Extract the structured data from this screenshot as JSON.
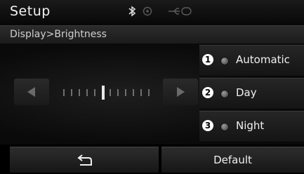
{
  "header": {
    "title": "Setup",
    "status_icons": [
      "bluetooth-icon",
      "gps-icon",
      "usb-icon"
    ]
  },
  "breadcrumb": {
    "text": "Display>Brightness"
  },
  "brightness": {
    "ticks_total": 12,
    "active_tick_index": 5
  },
  "options": [
    {
      "callout": "1",
      "label": "Automatic"
    },
    {
      "callout": "2",
      "label": "Day"
    },
    {
      "callout": "3",
      "label": "Night"
    }
  ],
  "footer": {
    "back_icon": "back-arrow-icon",
    "default_label": "Default"
  }
}
